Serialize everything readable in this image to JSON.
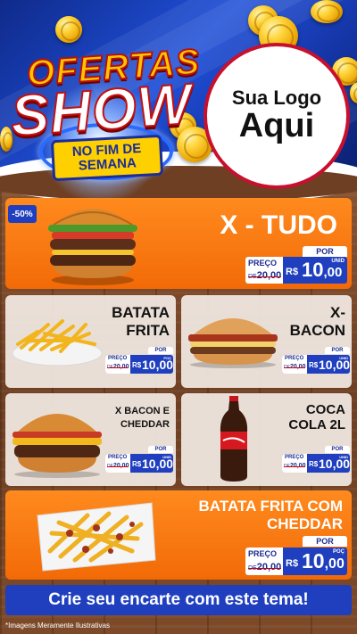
{
  "header": {
    "title_line1": "OFERTAS",
    "title_line2": "SHOW",
    "subtitle_line1": "NO FIM DE",
    "subtitle_line2": "SEMANA",
    "logo_line1": "Sua Logo",
    "logo_line2": "Aqui"
  },
  "featured": {
    "discount": "-50%",
    "name": "X - TUDO",
    "por": "POR",
    "preco": "PREÇO",
    "de": "DE",
    "old_price": "20,00",
    "currency": "R$",
    "price_int": "10",
    "price_dec": ",00",
    "unit": "UNID"
  },
  "items": [
    {
      "name_line1": "BATATA",
      "name_line2": "FRITA",
      "por": "POR",
      "preco": "PREÇO",
      "de": "DE",
      "old_price": "20,00",
      "currency": "R$",
      "price": "10,00",
      "unit": "POÇ"
    },
    {
      "name_line1": "X-",
      "name_line2": "BACON",
      "por": "POR",
      "preco": "PREÇO",
      "de": "DE",
      "old_price": "20,00",
      "currency": "R$",
      "price": "10,00",
      "unit": "UNID"
    },
    {
      "name_line1": "X BACON E",
      "name_line2": "CHEDDAR",
      "por": "POR",
      "preco": "PREÇO",
      "de": "DE",
      "old_price": "20,00",
      "currency": "R$",
      "price": "10,00",
      "unit": "UNID"
    },
    {
      "name_line1": "COCA",
      "name_line2": "COLA 2L",
      "por": "POR",
      "preco": "PREÇO",
      "de": "DE",
      "old_price": "20,00",
      "currency": "R$",
      "price": "10,00",
      "unit": "UNID"
    }
  ],
  "bottom_item": {
    "name_line1": "BATATA FRITA COM",
    "name_line2": "CHEDDAR",
    "por": "POR",
    "preco": "PREÇO",
    "de": "DE",
    "old_price": "20,00",
    "currency": "R$",
    "price_int": "10",
    "price_dec": ",00",
    "unit": "POÇ"
  },
  "footer": {
    "cta": "Crie seu encarte com este tema!",
    "note": "*Imagens Meramente Ilustrativas"
  },
  "colors": {
    "header_blue": "#1f4fd8",
    "card_orange": "#f26a07",
    "price_blue": "#1f3fbf",
    "logo_border": "#c8102e"
  }
}
